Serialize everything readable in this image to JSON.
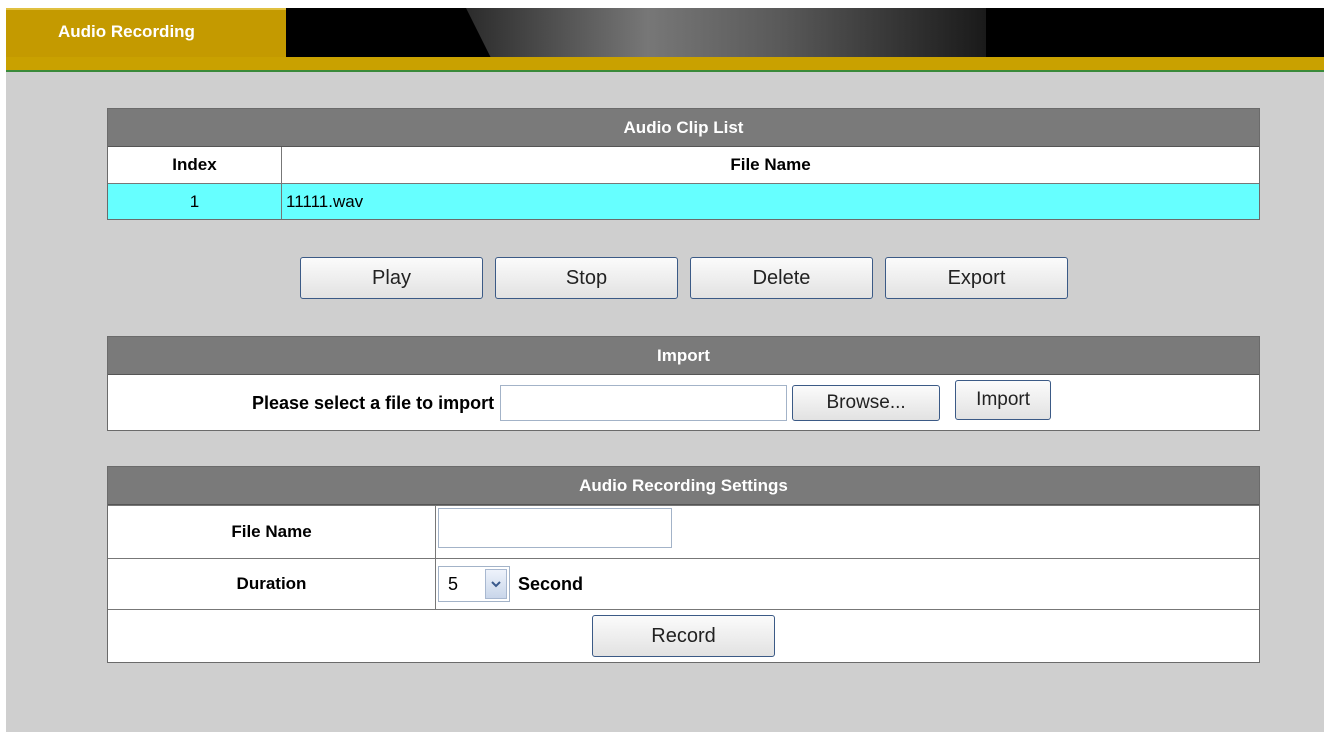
{
  "header": {
    "tab_label": "Audio Recording"
  },
  "clip_list": {
    "title": "Audio Clip List",
    "columns": [
      "Index",
      "File Name"
    ],
    "rows": [
      {
        "index": "1",
        "file_name": "11111.wav"
      }
    ]
  },
  "actions": {
    "play": "Play",
    "stop": "Stop",
    "delete": "Delete",
    "export": "Export"
  },
  "import": {
    "title": "Import",
    "label": "Please select a file to import",
    "file_value": "",
    "browse": "Browse...",
    "import_button": "Import"
  },
  "settings": {
    "title": "Audio Recording Settings",
    "file_name_label": "File Name",
    "file_name_value": "",
    "duration_label": "Duration",
    "duration_value": "5",
    "duration_unit": "Second",
    "record": "Record"
  },
  "colors": {
    "header_gold": "#c49a00",
    "panel_header": "#7a7a7a",
    "selected_row": "#66ffff",
    "background": "#cfcfcf"
  }
}
